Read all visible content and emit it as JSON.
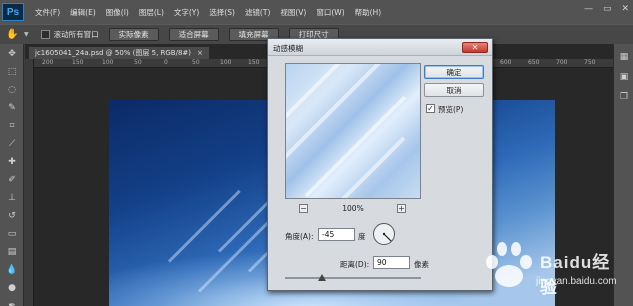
{
  "app": {
    "logo": "Ps"
  },
  "menu": {
    "items": [
      "文件(F)",
      "编辑(E)",
      "图像(I)",
      "图层(L)",
      "文字(Y)",
      "选择(S)",
      "滤镜(T)",
      "视图(V)",
      "窗口(W)",
      "帮助(H)"
    ]
  },
  "window_controls": {
    "minimize": "—",
    "restore": "▭",
    "close": "✕"
  },
  "options": {
    "tool_icon": "hand-icon",
    "scroll_all_label": "滚动所有窗口",
    "actual_pixels_label": "实际像素",
    "fit_screen_label": "适合屏幕",
    "fill_screen_label": "填充屏幕",
    "print_size_label": "打印尺寸"
  },
  "document": {
    "tab_title": "jc1605041_24a.psd @ 50% (图层 5, RGB/8#)",
    "tab_close": "×",
    "ruler_ticks": [
      "200",
      "150",
      "100",
      "50",
      "0",
      "50",
      "100",
      "150",
      "200",
      "250",
      "300",
      "350",
      "400",
      "450",
      "500",
      "550",
      "600",
      "650",
      "700",
      "750"
    ]
  },
  "dialog": {
    "title": "动感模糊",
    "close_symbol": "✕",
    "ok_label": "确定",
    "cancel_label": "取消",
    "preview_label": "预览(P)",
    "preview_checked": true,
    "preview_check_mark": "✓",
    "zoom_out_symbol": "−",
    "zoom_in_symbol": "+",
    "zoom_value": "100%",
    "angle_label": "角度(A):",
    "angle_value": "-45",
    "angle_unit": "度",
    "angle_degrees": -45,
    "distance_label": "距离(D):",
    "distance_value": "90",
    "distance_unit": "像素",
    "distance_slider_fraction": 0.27
  },
  "watermark": {
    "brand": "Baidu经验",
    "url": "jingyan.baidu.com"
  },
  "colors": {
    "ok_border": "#3d7bc7",
    "close_red": "#c4392b",
    "canvas_blue": "#134088"
  }
}
